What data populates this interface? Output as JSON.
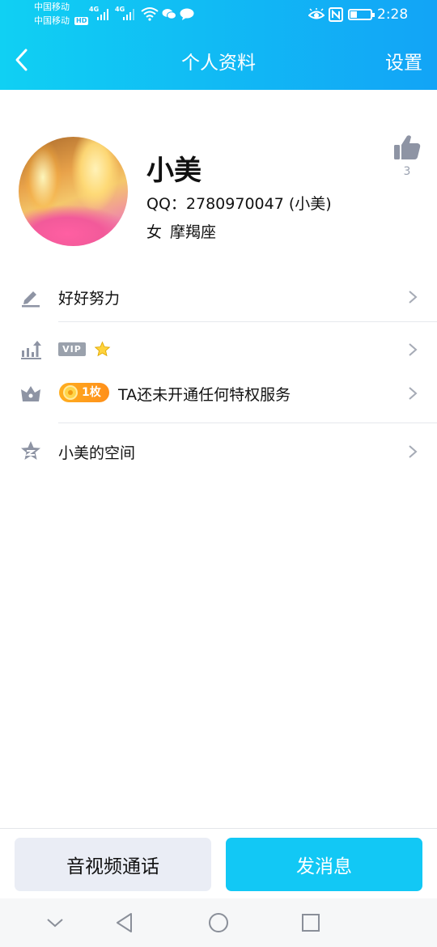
{
  "status_bar": {
    "carrier_1": "中国移动",
    "carrier_2": "中国移动",
    "hd_badge": "HD",
    "signal_1_type": "4G",
    "signal_2_type": "4G",
    "time": "2:28",
    "battery_level": 0.35,
    "icons": [
      "wifi-icon",
      "wechat-icon",
      "message-icon",
      "eye-comfort-icon",
      "nfc-icon",
      "battery-icon"
    ]
  },
  "nav": {
    "title": "个人资料",
    "settings_label": "设置",
    "back_icon": "chevron-left-icon"
  },
  "profile": {
    "name": "小美",
    "qq": "QQ：2780970047 (小美)",
    "gender": "女",
    "zodiac": "摩羯座",
    "like_count": "3",
    "like_icon": "thumbs-up-icon"
  },
  "rows": {
    "signature": {
      "label": "好好努力",
      "icon": "pencil-icon"
    },
    "vip": {
      "badge": "VIP",
      "star_icon": "star-icon",
      "icon": "level-up-chart-icon"
    },
    "privilege": {
      "coin_label": "1枚",
      "label": "TA还未开通任何特权服务",
      "icon": "crown-icon"
    },
    "space": {
      "label": "小美的空间",
      "icon": "qzone-star-icon"
    }
  },
  "actions": {
    "call_label": "音视频通话",
    "message_label": "发消息"
  },
  "colors": {
    "header_start": "#10d0f3",
    "header_end": "#12a4f6",
    "primary_button": "#12c8f5",
    "secondary_button": "#eaedf5",
    "icon_gray": "#8e94a4"
  }
}
